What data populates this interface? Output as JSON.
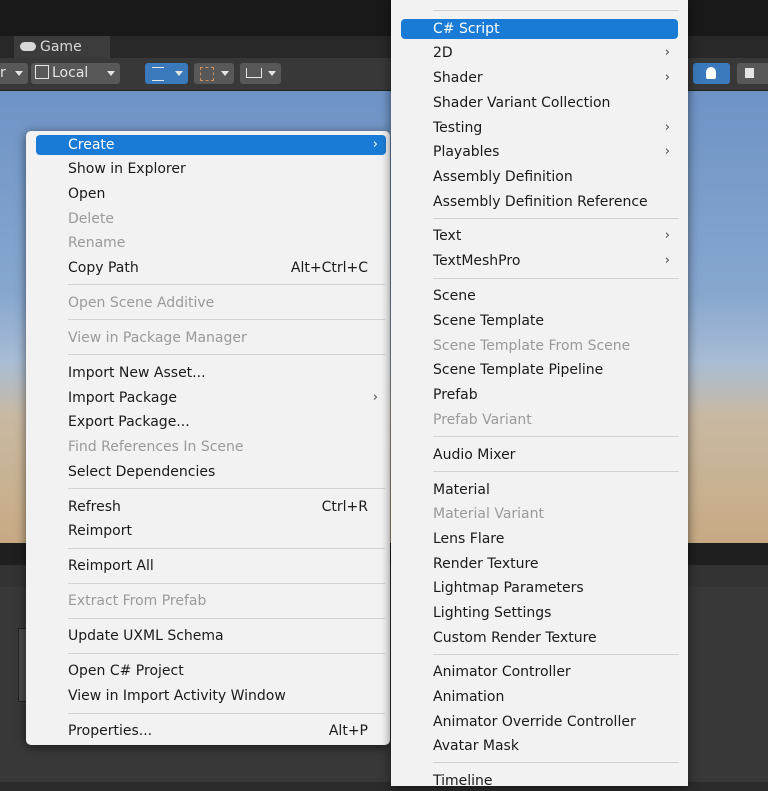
{
  "editor": {
    "game_tab": "Game",
    "toolbar": {
      "pivot_tail": "r",
      "space": "Local"
    }
  },
  "context_menu": {
    "items": [
      {
        "label": "Create",
        "highlighted": true,
        "submenu": true
      },
      {
        "label": "Show in Explorer"
      },
      {
        "label": "Open"
      },
      {
        "label": "Delete",
        "disabled": true
      },
      {
        "label": "Rename",
        "disabled": true
      },
      {
        "label": "Copy Path",
        "shortcut": "Alt+Ctrl+C"
      },
      {
        "label": "Open Scene Additive",
        "disabled": true
      },
      {
        "label": "View in Package Manager",
        "disabled": true
      },
      {
        "label": "Import New Asset..."
      },
      {
        "label": "Import Package",
        "submenu": true
      },
      {
        "label": "Export Package..."
      },
      {
        "label": "Find References In Scene",
        "disabled": true
      },
      {
        "label": "Select Dependencies"
      },
      {
        "label": "Refresh",
        "shortcut": "Ctrl+R"
      },
      {
        "label": "Reimport"
      },
      {
        "label": "Reimport All"
      },
      {
        "label": "Extract From Prefab",
        "disabled": true
      },
      {
        "label": "Update UXML Schema"
      },
      {
        "label": "Open C# Project"
      },
      {
        "label": "View in Import Activity Window"
      },
      {
        "label": "Properties...",
        "shortcut": "Alt+P"
      }
    ]
  },
  "create_submenu": {
    "items": [
      {
        "label": "C# Script",
        "highlighted": true
      },
      {
        "label": "2D",
        "submenu": true
      },
      {
        "label": "Shader",
        "submenu": true
      },
      {
        "label": "Shader Variant Collection"
      },
      {
        "label": "Testing",
        "submenu": true
      },
      {
        "label": "Playables",
        "submenu": true
      },
      {
        "label": "Assembly Definition"
      },
      {
        "label": "Assembly Definition Reference"
      },
      {
        "label": "Text",
        "submenu": true
      },
      {
        "label": "TextMeshPro",
        "submenu": true
      },
      {
        "label": "Scene"
      },
      {
        "label": "Scene Template"
      },
      {
        "label": "Scene Template From Scene",
        "disabled": true
      },
      {
        "label": "Scene Template Pipeline"
      },
      {
        "label": "Prefab"
      },
      {
        "label": "Prefab Variant",
        "disabled": true
      },
      {
        "label": "Audio Mixer"
      },
      {
        "label": "Material"
      },
      {
        "label": "Material Variant",
        "disabled": true
      },
      {
        "label": "Lens Flare"
      },
      {
        "label": "Render Texture"
      },
      {
        "label": "Lightmap Parameters"
      },
      {
        "label": "Lighting Settings"
      },
      {
        "label": "Custom Render Texture"
      },
      {
        "label": "Animator Controller"
      },
      {
        "label": "Animation"
      },
      {
        "label": "Animator Override Controller"
      },
      {
        "label": "Avatar Mask"
      },
      {
        "label": "Timeline"
      }
    ]
  },
  "colors": {
    "menu_background": "#f2f2f2",
    "highlight": "#1a7bd6",
    "disabled_text": "#9a9a9a"
  }
}
